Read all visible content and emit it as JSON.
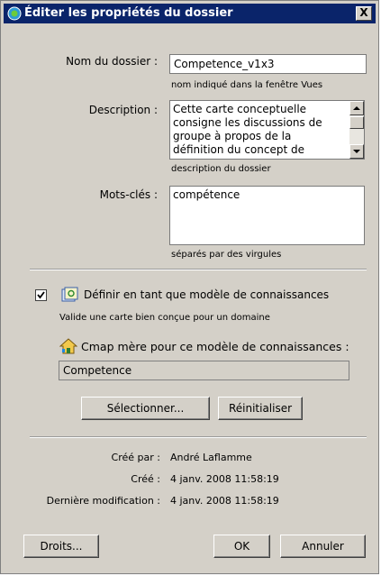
{
  "window": {
    "title": "Éditer les propriétés du dossier",
    "close_symbol": "X"
  },
  "form": {
    "name_label": "Nom du dossier :",
    "name_value": "Competence_v1x3",
    "name_hint": "nom indiqué dans la fenêtre Vues",
    "description_label": "Description :",
    "description_lines": [
      "Cette carte conceptuelle",
      "consigne les discussions de",
      "groupe à propos de la",
      "définition du concept de"
    ],
    "description_hint": "description du dossier",
    "keywords_label": "Mots-clés :",
    "keywords_value": "compétence",
    "keywords_hint": "séparés par des virgules"
  },
  "knowledge_model": {
    "checkbox_checked": true,
    "checkbox_label": "Définir en tant que modèle de connaissances",
    "hint": "Valide une carte bien conçue pour un domaine",
    "parent_label": "Cmap mère pour ce modèle de connaissances :",
    "parent_value": "Competence",
    "select_button": "Sélectionner...",
    "reset_button": "Réinitialiser"
  },
  "info": {
    "created_by_label": "Créé par :",
    "created_by_value": "André Laflamme",
    "created_label": "Créé :",
    "created_value": "4 janv. 2008 11:58:19",
    "modified_label": "Dernière modification :",
    "modified_value": "4 janv. 2008 11:58:19"
  },
  "buttons": {
    "rights": "Droits...",
    "ok": "OK",
    "cancel": "Annuler"
  },
  "colors": {
    "titlebar": "#0a246a",
    "dialog_bg": "#d4d0c8"
  }
}
